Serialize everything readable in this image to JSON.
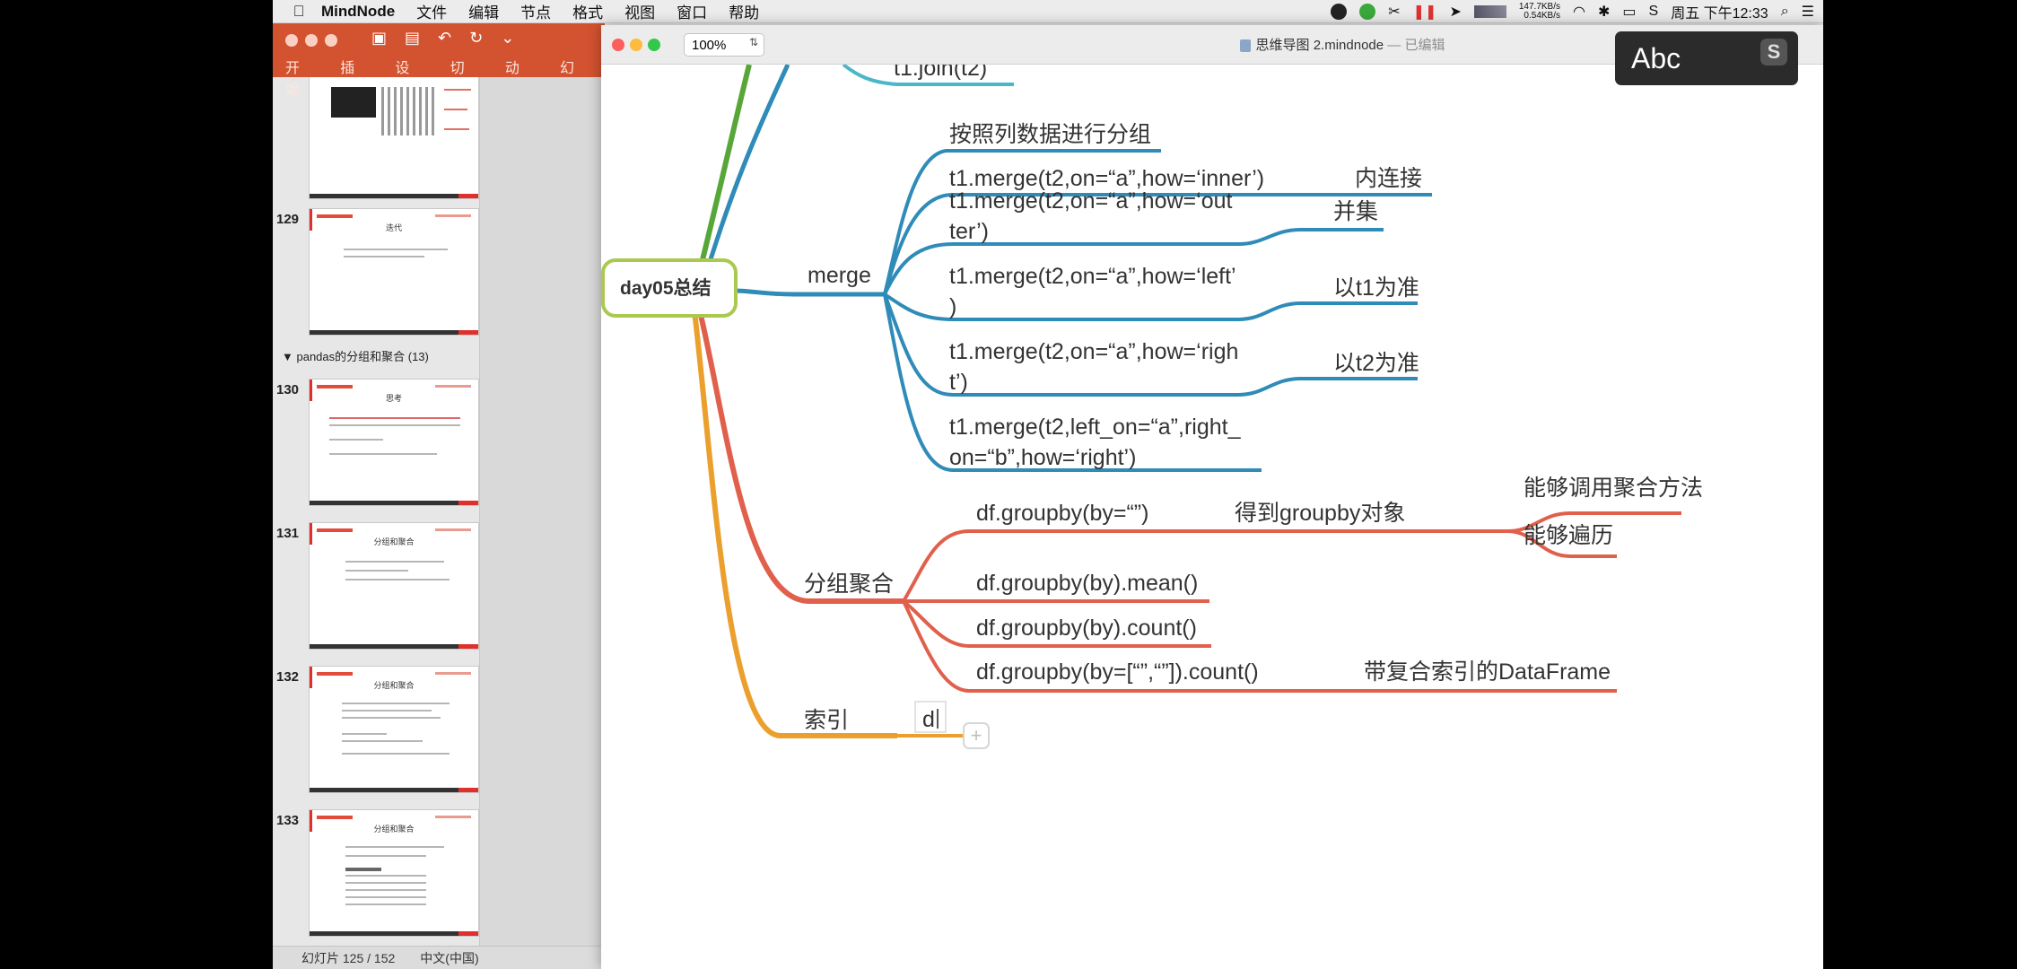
{
  "menubar": {
    "app_name": "MindNode",
    "items": [
      "文件",
      "编辑",
      "节点",
      "格式",
      "视图",
      "窗口",
      "帮助"
    ],
    "net_up": "147.7KB/s",
    "net_down": "0.54KB/s",
    "clock": "周五 下午12:33"
  },
  "ppt": {
    "tabs": [
      "开始",
      "插入",
      "设计",
      "切换",
      "动画",
      "幻"
    ],
    "slides": [
      {
        "num": "",
        "title": ""
      },
      {
        "num": "129",
        "title": "迭代"
      },
      {
        "num": "130",
        "title": "思考"
      },
      {
        "num": "131",
        "title": "分组和聚合"
      },
      {
        "num": "132",
        "title": "分组和聚合"
      },
      {
        "num": "133",
        "title": "分组和聚合"
      }
    ],
    "section": "pandas的分组和聚合 (13)",
    "status_slide": "幻灯片 125 / 152",
    "status_lang": "中文(中国)"
  },
  "mindnode": {
    "zoom": "100%",
    "doc_title": "思维导图 2.mindnode",
    "doc_state": "— 已编辑",
    "root": "day05总结",
    "top_partial": "t1.join(t2)",
    "merge": {
      "label": "merge",
      "children": [
        {
          "lines": [
            "按照列数据进行分组"
          ],
          "note": ""
        },
        {
          "lines": [
            "t1.merge(t2,on=“a”,how=‘inner’)"
          ],
          "note": "内连接"
        },
        {
          "lines": [
            "t1.merge(t2,on=“a”,how=‘out",
            "ter’)"
          ],
          "note": "并集"
        },
        {
          "lines": [
            "t1.merge(t2,on=“a”,how=‘left’",
            ")"
          ],
          "note": "以t1为准"
        },
        {
          "lines": [
            "t1.merge(t2,on=“a”,how=‘righ",
            "t’)"
          ],
          "note": "以t2为准"
        },
        {
          "lines": [
            "t1.merge(t2,left_on=“a”,right_",
            "on=“b”,how=‘right’)"
          ],
          "note": ""
        }
      ]
    },
    "group": {
      "label": "分组聚合",
      "children": [
        {
          "text": "df.groupby(by=“”)",
          "note": "得到groupby对象",
          "subnotes": [
            "能够调用聚合方法",
            "能够遍历"
          ]
        },
        {
          "text": "df.groupby(by).mean()"
        },
        {
          "text": "df.groupby(by).count()"
        },
        {
          "text": "df.groupby(by=[“”,“”]).count()",
          "note": "带复合索引的DataFrame"
        }
      ]
    },
    "index": {
      "label": "索引",
      "editing_text": "d"
    }
  },
  "overlay": {
    "text": "Abc"
  },
  "colors": {
    "blue": "#2f8bb8",
    "red": "#e0604c",
    "orange": "#eba02e",
    "green": "#57a638",
    "root_border": "#a9c94f"
  }
}
